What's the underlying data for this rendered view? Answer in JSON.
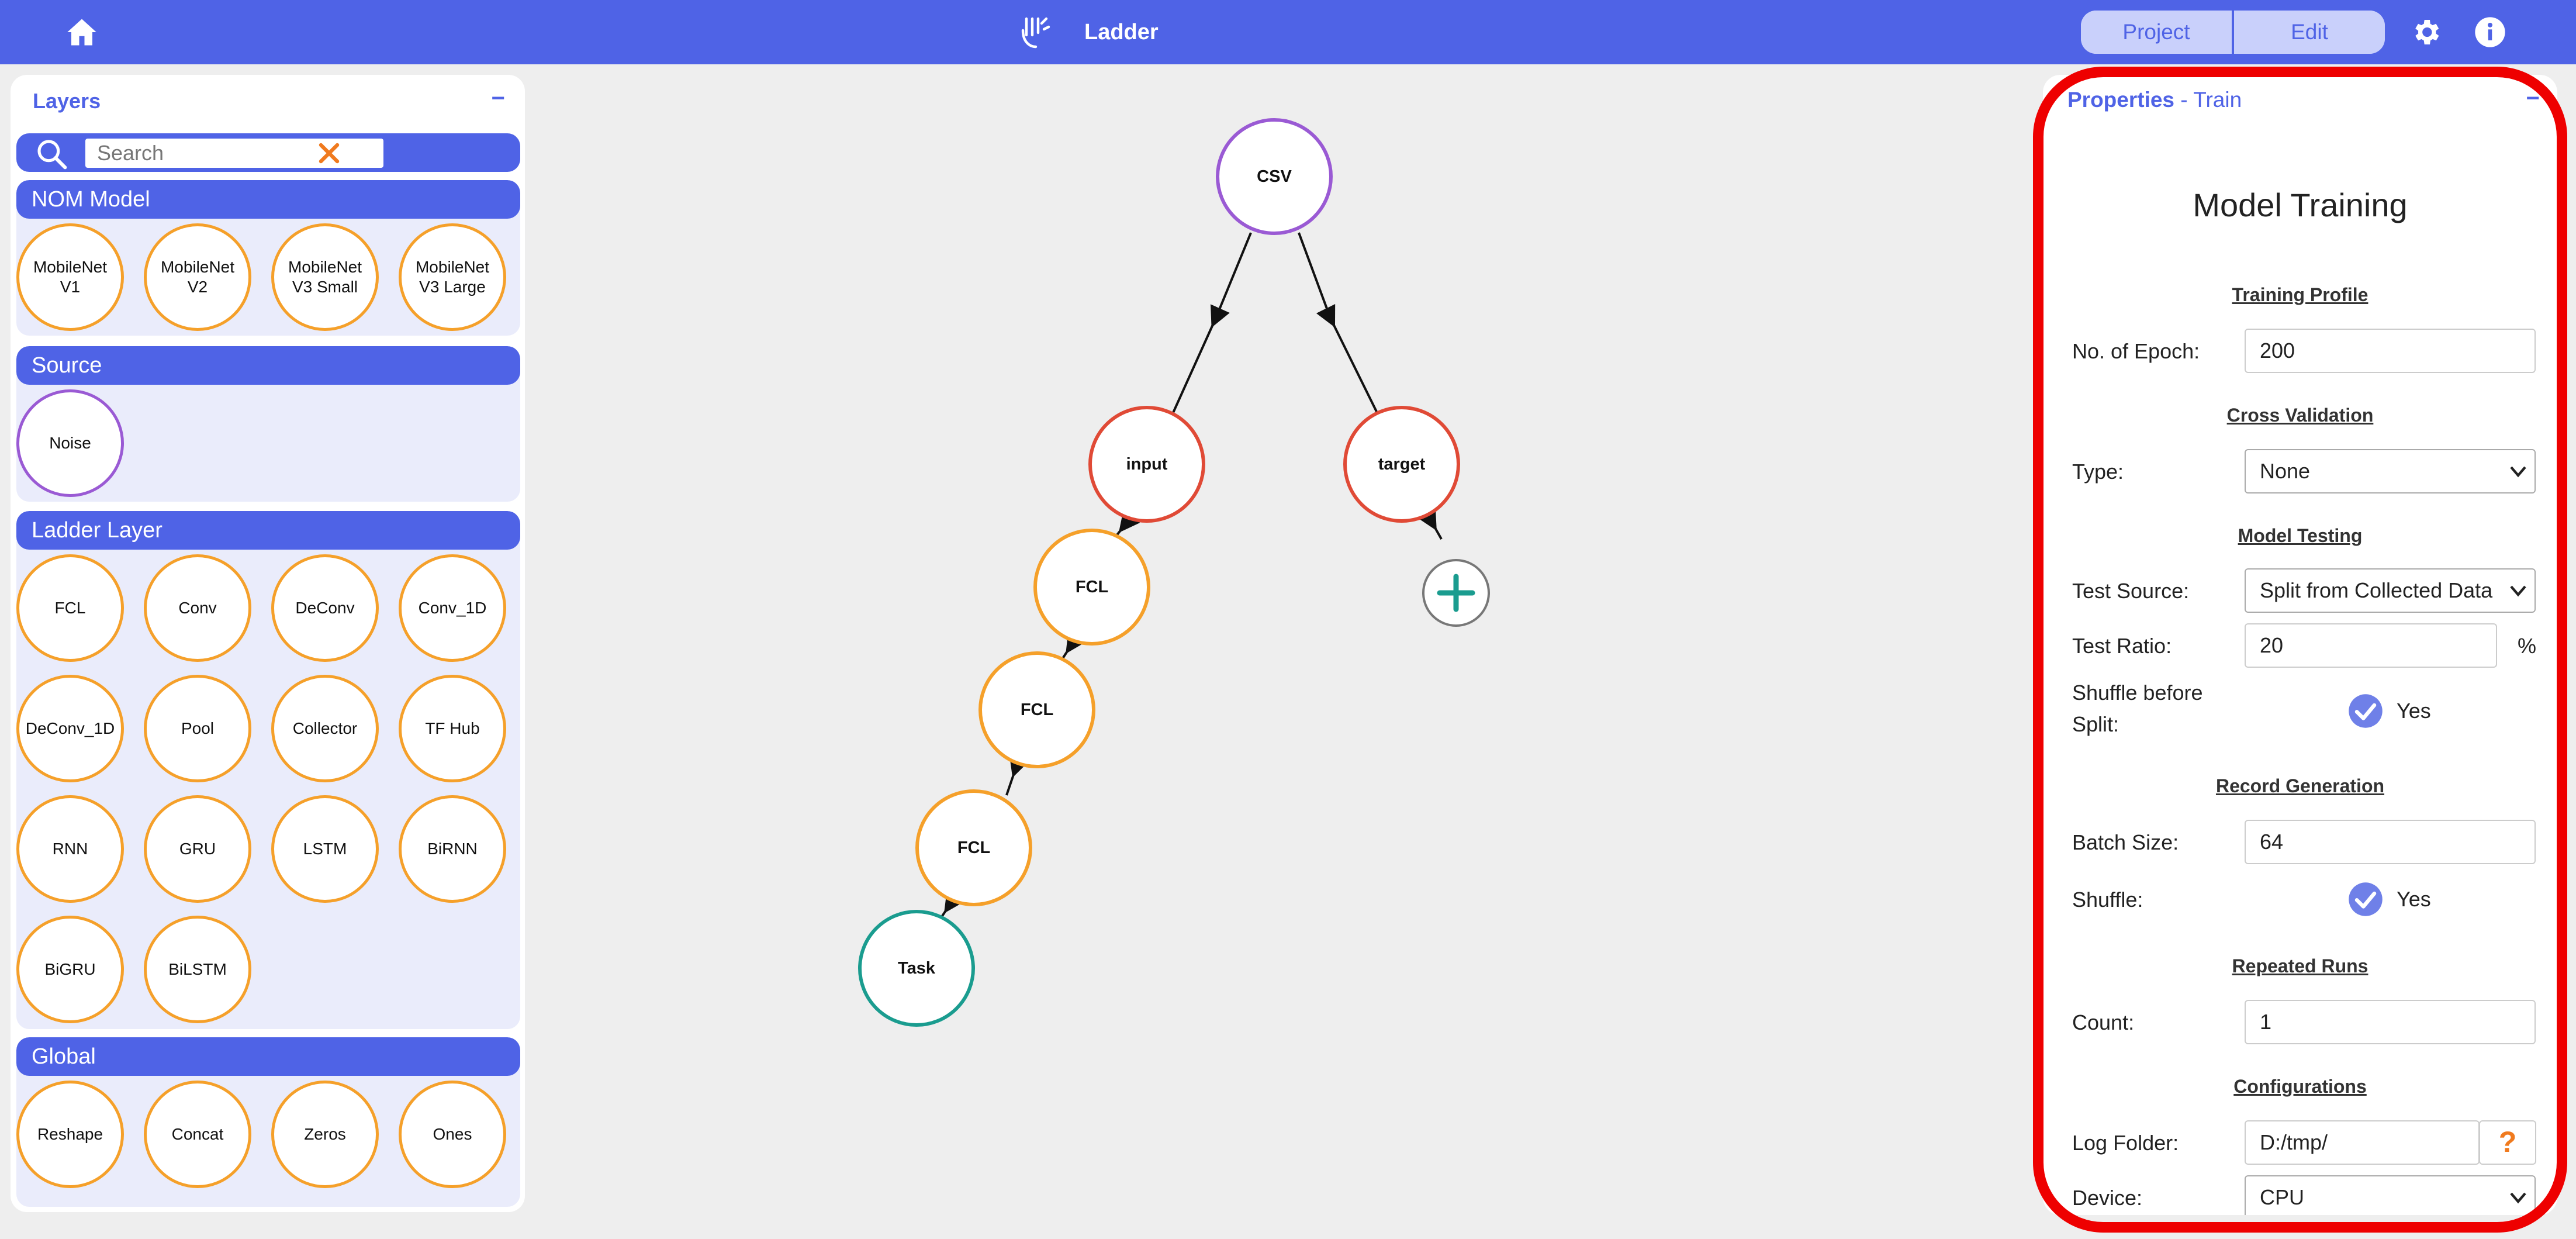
{
  "header": {
    "app_title": "Ladder",
    "tab_project": "Project",
    "tab_edit": "Edit"
  },
  "layers": {
    "title": "Layers",
    "collapse": "−",
    "search_placeholder": "Search",
    "sections": {
      "nom_model": {
        "title": "NOM Model",
        "items": [
          "MobileNet V1",
          "MobileNet V2",
          "MobileNet V3 Small",
          "MobileNet V3 Large"
        ]
      },
      "source": {
        "title": "Source",
        "items": [
          "Noise"
        ]
      },
      "ladder_layer": {
        "title": "Ladder Layer",
        "items": [
          "FCL",
          "Conv",
          "DeConv",
          "Conv_1D",
          "DeConv_1D",
          "Pool",
          "Collector",
          "TF Hub",
          "RNN",
          "GRU",
          "LSTM",
          "BiRNN",
          "BiGRU",
          "BiLSTM"
        ]
      },
      "global": {
        "title": "Global",
        "items": [
          "Reshape",
          "Concat",
          "Zeros",
          "Ones"
        ]
      }
    }
  },
  "graph": {
    "nodes": {
      "csv": "CSV",
      "input": "input",
      "target": "target",
      "fcl1": "FCL",
      "fcl2": "FCL",
      "fcl3": "FCL",
      "task": "Task"
    }
  },
  "properties": {
    "title": "Properties",
    "subtitle": "- Train",
    "collapse": "−",
    "form_title": "Model Training",
    "training_profile": {
      "title": "Training Profile",
      "epoch_label": "No. of Epoch:",
      "epoch_value": "200"
    },
    "cross_validation": {
      "title": "Cross Validation",
      "type_label": "Type:",
      "type_value": "None"
    },
    "model_testing": {
      "title": "Model Testing",
      "source_label": "Test Source:",
      "source_value": "Split from Collected Data",
      "ratio_label": "Test Ratio:",
      "ratio_value": "20",
      "ratio_unit": "%",
      "shuffle_label_1": "Shuffle before",
      "shuffle_label_2": "Split:",
      "shuffle_checked": true,
      "shuffle_value": "Yes"
    },
    "record_generation": {
      "title": "Record Generation",
      "batch_label": "Batch Size:",
      "batch_value": "64",
      "shuffle_label": "Shuffle:",
      "shuffle_checked": true,
      "shuffle_value": "Yes"
    },
    "repeated_runs": {
      "title": "Repeated Runs",
      "count_label": "Count:",
      "count_value": "1"
    },
    "configurations": {
      "title": "Configurations",
      "log_label": "Log Folder:",
      "log_value": "D:/tmp/",
      "help_symbol": "?",
      "device_label": "Device:",
      "device_value": "CPU"
    }
  },
  "colors": {
    "brand": "#4f63e6",
    "source_node": "#9a5ad4",
    "io_node": "#e04a36",
    "layer_node": "#f5a02a",
    "task_node": "#1a9c8f",
    "highlight": "#ee0000"
  }
}
